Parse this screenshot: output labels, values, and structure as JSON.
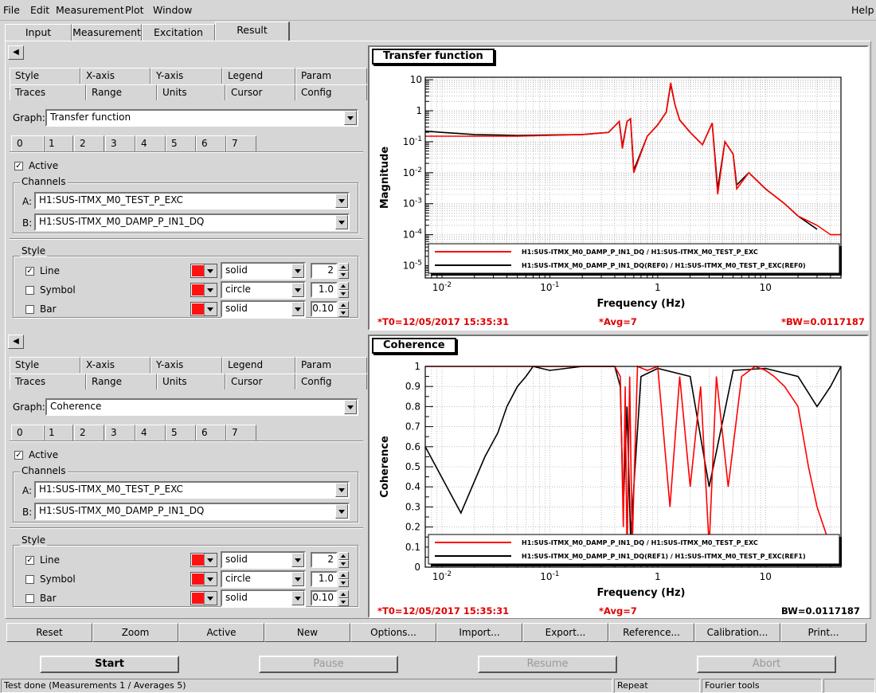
{
  "menu": {
    "file": "File",
    "edit": "Edit",
    "measurement": "Measurement",
    "plot": "Plot",
    "window": "Window",
    "help": "Help"
  },
  "main_tabs": [
    "Input",
    "Measurement",
    "Excitation",
    "Result"
  ],
  "active_main_tab": "Result",
  "subtabs_row1": [
    "Style",
    "X-axis",
    "Y-axis",
    "Legend",
    "Param"
  ],
  "subtabs_row2": [
    "Traces",
    "Range",
    "Units",
    "Cursor",
    "Config"
  ],
  "trace_numbers": [
    "0",
    "1",
    "2",
    "3",
    "4",
    "5",
    "6",
    "7"
  ],
  "labels": {
    "graph": "Graph:",
    "active": "Active",
    "channels": "Channels",
    "a": "A:",
    "b": "B:",
    "style": "Style",
    "line": "Line",
    "symbol": "Symbol",
    "bar": "Bar"
  },
  "panels": [
    {
      "graph": "Transfer function",
      "channel_a": "H1:SUS-ITMX_M0_TEST_P_EXC",
      "channel_b": "H1:SUS-ITMX_M0_DAMP_P_IN1_DQ",
      "line_style": "solid",
      "line_width": "2",
      "symbol_style": "circle",
      "symbol_size": "1.0",
      "bar_style": "solid",
      "bar_width": "0.10"
    },
    {
      "graph": "Coherence",
      "channel_a": "H1:SUS-ITMX_M0_TEST_P_EXC",
      "channel_b": "H1:SUS-ITMX_M0_DAMP_P_IN1_DQ",
      "line_style": "solid",
      "line_width": "2",
      "symbol_style": "circle",
      "symbol_size": "1.0",
      "bar_style": "solid",
      "bar_width": "0.10"
    }
  ],
  "colors": {
    "trace_red": "#ff0000",
    "trace_black": "#000000"
  },
  "chart_data": [
    {
      "type": "line",
      "title": "Transfer function",
      "xlabel": "Frequency (Hz)",
      "ylabel": "Magnitude",
      "xscale": "log",
      "yscale": "log",
      "xlim": [
        0.007,
        50
      ],
      "ylim": [
        4e-06,
        12
      ],
      "xticks": [
        "10^-2",
        "10^-1",
        "1",
        "10"
      ],
      "yticks": [
        "10^-5",
        "10^-4",
        "10^-3",
        "10^-2",
        "10^-1",
        "1",
        "10"
      ],
      "grid": true,
      "legend_position": "bottom-right",
      "series": [
        {
          "name": "H1:SUS-ITMX_M0_DAMP_P_IN1_DQ / H1:SUS-ITMX_M0_TEST_P_EXC",
          "color": "#ff0000",
          "x": [
            0.007,
            0.01,
            0.02,
            0.05,
            0.1,
            0.2,
            0.35,
            0.44,
            0.47,
            0.52,
            0.56,
            0.6,
            0.8,
            1.0,
            1.2,
            1.32,
            1.45,
            1.6,
            2.0,
            2.6,
            3.2,
            3.6,
            4.2,
            5.0,
            5.4,
            7,
            10,
            15,
            20,
            30,
            40,
            50
          ],
          "y": [
            0.15,
            0.15,
            0.15,
            0.15,
            0.16,
            0.17,
            0.2,
            0.45,
            0.06,
            0.45,
            0.55,
            0.01,
            0.15,
            0.35,
            0.9,
            8,
            1.5,
            0.5,
            0.2,
            0.08,
            0.4,
            0.002,
            0.1,
            0.04,
            0.003,
            0.01,
            0.003,
            0.001,
            0.0004,
            0.0002,
            0.0001,
            0.0001
          ]
        },
        {
          "name": "H1:SUS-ITMX_M0_DAMP_P_IN1_DQ(REF0) / H1:SUS-ITMX_M0_TEST_P_EXC(REF0)",
          "color": "#000000",
          "x": [
            0.007,
            0.01,
            0.02,
            0.05,
            0.1,
            0.2,
            0.35,
            0.44,
            0.47,
            0.52,
            0.56,
            0.6,
            0.8,
            1.0,
            1.2,
            1.32,
            1.45,
            1.6,
            2.0,
            2.6,
            3.2,
            3.6,
            4.2,
            5.0,
            5.4,
            7,
            10,
            15,
            20,
            30
          ],
          "y": [
            0.22,
            0.2,
            0.17,
            0.16,
            0.165,
            0.17,
            0.2,
            0.45,
            0.07,
            0.45,
            0.55,
            0.012,
            0.15,
            0.35,
            0.9,
            7,
            1.5,
            0.5,
            0.2,
            0.08,
            0.4,
            0.003,
            0.1,
            0.04,
            0.004,
            0.01,
            0.003,
            0.001,
            0.0004,
            0.00015
          ]
        }
      ],
      "footer": {
        "t0": "*T0=12/05/2017 15:35:31",
        "avg": "*Avg=7",
        "bw": "*BW=0.0117187"
      }
    },
    {
      "type": "line",
      "title": "Coherence",
      "xlabel": "Frequency (Hz)",
      "ylabel": "Coherence",
      "xscale": "log",
      "yscale": "linear",
      "xlim": [
        0.007,
        50
      ],
      "ylim": [
        0,
        1
      ],
      "xticks": [
        "10^-2",
        "10^-1",
        "1",
        "10"
      ],
      "yticks": [
        "0",
        "0.1",
        "0.2",
        "0.3",
        "0.4",
        "0.5",
        "0.6",
        "0.7",
        "0.8",
        "0.9",
        "1"
      ],
      "grid": true,
      "legend_position": "bottom-right",
      "series": [
        {
          "name": "H1:SUS-ITMX_M0_DAMP_P_IN1_DQ / H1:SUS-ITMX_M0_TEST_P_EXC",
          "color": "#ff0000",
          "x": [
            0.007,
            0.1,
            0.4,
            0.45,
            0.48,
            0.5,
            0.52,
            0.55,
            0.58,
            0.65,
            0.8,
            1.0,
            1.3,
            1.6,
            2.0,
            2.5,
            3.0,
            3.5,
            4.5,
            6,
            8,
            10,
            12,
            15,
            20,
            25,
            30,
            40,
            50
          ],
          "y": [
            1,
            1,
            1,
            0.95,
            0.2,
            0.9,
            0.05,
            0.95,
            0.1,
            1,
            0.98,
            1,
            0.3,
            0.95,
            0.4,
            0.9,
            0.1,
            0.95,
            0.4,
            0.95,
            1,
            0.98,
            0.95,
            0.9,
            0.8,
            0.5,
            0.3,
            0.1,
            0.05
          ]
        },
        {
          "name": "H1:SUS-ITMX_M0_DAMP_P_IN1_DQ(REF1) / H1:SUS-ITMX_M0_TEST_P_EXC(REF1)",
          "color": "#000000",
          "x": [
            0.007,
            0.015,
            0.025,
            0.033,
            0.04,
            0.05,
            0.06,
            0.07,
            0.1,
            0.2,
            0.4,
            0.45,
            0.48,
            0.52,
            0.56,
            0.7,
            1.0,
            2.0,
            3.0,
            5.0,
            10,
            20,
            30,
            40,
            50
          ],
          "y": [
            0.6,
            0.27,
            0.55,
            0.67,
            0.8,
            0.9,
            0.95,
            1,
            0.98,
            1,
            1,
            0.9,
            0.3,
            0.8,
            0.15,
            0.95,
            0.99,
            0.95,
            0.4,
            0.98,
            0.99,
            0.95,
            0.8,
            0.9,
            1
          ]
        }
      ],
      "footer": {
        "t0": "*T0=12/05/2017 15:35:31",
        "avg": "*Avg=7",
        "bw": "BW=0.0117187"
      }
    }
  ],
  "toolbar": [
    "Reset",
    "Zoom",
    "Active",
    "New",
    "Options...",
    "Import...",
    "Export...",
    "Reference...",
    "Calibration...",
    "Print..."
  ],
  "controls": {
    "start": "Start",
    "pause": "Pause",
    "resume": "Resume",
    "abort": "Abort"
  },
  "status": {
    "main": "Test done (Measurements 1 / Averages 5)",
    "repeat": "Repeat",
    "tools": "Fourier tools"
  }
}
